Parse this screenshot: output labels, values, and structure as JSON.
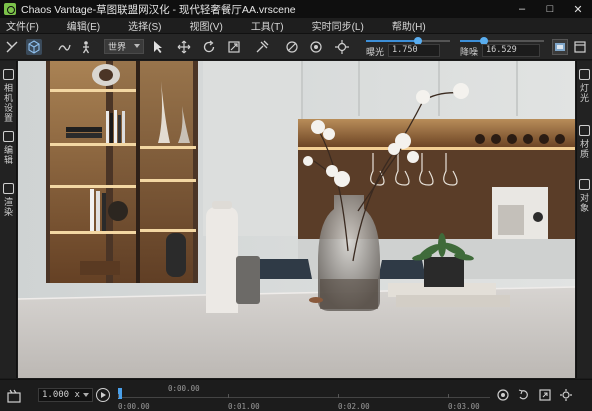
{
  "window": {
    "title": "Chaos Vantage-草图联盟网汉化 - 现代轻奢餐厅AA.vrscene",
    "controls": [
      "minimize",
      "maximize",
      "close"
    ]
  },
  "menu": [
    "文件(F)",
    "编辑(E)",
    "选择(S)",
    "视图(V)",
    "工具(T)",
    "实时同步(L)",
    "帮助(H)"
  ],
  "toolbar": {
    "space_select": "世界",
    "exposure_label": "曝光",
    "exposure_value": "1.750",
    "exposure_level": 0.62,
    "denoise_label": "降噪",
    "denoise_value": "16.529",
    "denoise_level": 0.28,
    "icons": [
      "grid-icon",
      "cube-icon",
      "walk-icon",
      "person-icon",
      "select-arrow-icon",
      "move-icon",
      "rotate-icon",
      "scale-icon",
      "pick-icon",
      "lens-icon",
      "camera-icon",
      "target-icon"
    ]
  },
  "left_panel": {
    "items": [
      {
        "icon": "camera-settings-icon",
        "label": "相机设置"
      },
      {
        "icon": "edit-icon",
        "label": "编辑"
      },
      {
        "icon": "render-icon",
        "label": "渲染"
      }
    ]
  },
  "right_panel": {
    "items": [
      {
        "icon": "light-icon",
        "label": "灯光"
      },
      {
        "icon": "material-icon",
        "label": "材质"
      },
      {
        "icon": "object-icon",
        "label": "对象"
      }
    ]
  },
  "timeline": {
    "speed": "1.000 x",
    "current_time": "0:00.00",
    "ticks": [
      "0:00.00",
      "0:01.00",
      "0:02.00",
      "0:03.00"
    ]
  }
}
